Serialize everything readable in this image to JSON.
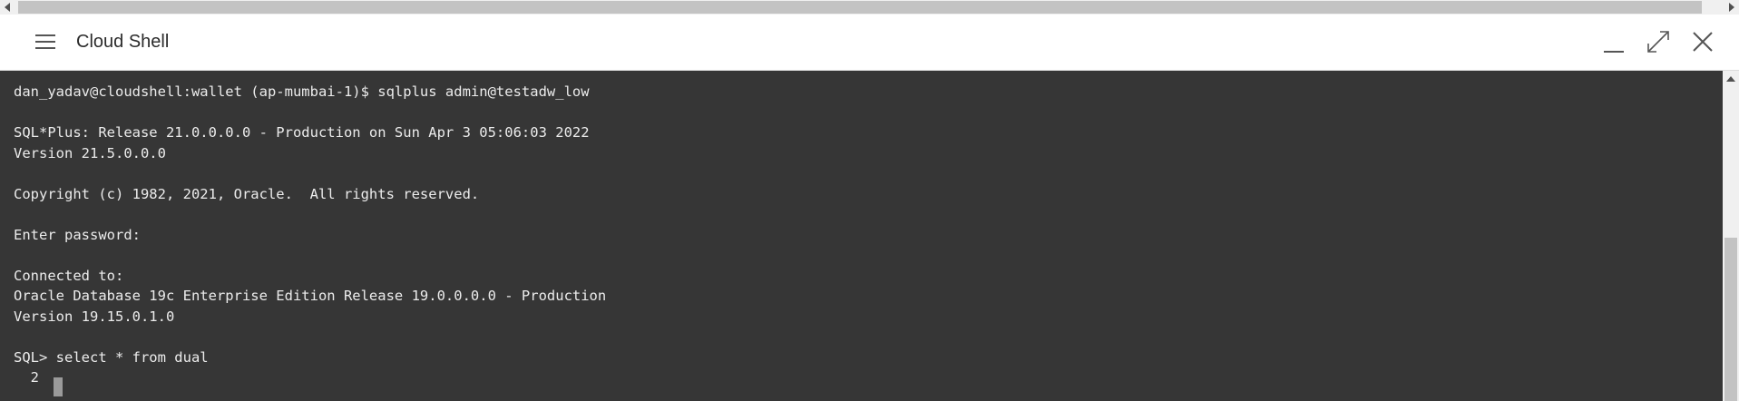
{
  "window": {
    "title": "Cloud Shell"
  },
  "header_icons": {
    "menu": "hamburger-menu-icon",
    "minimize": "minimize-icon",
    "maximize": "maximize-icon",
    "close": "close-icon"
  },
  "terminal": {
    "lines": [
      "dan_yadav@cloudshell:wallet (ap-mumbai-1)$ sqlplus admin@testadw_low",
      "",
      "SQL*Plus: Release 21.0.0.0.0 - Production on Sun Apr 3 05:06:03 2022",
      "Version 21.5.0.0.0",
      "",
      "Copyright (c) 1982, 2021, Oracle.  All rights reserved.",
      "",
      "Enter password:",
      "",
      "Connected to:",
      "Oracle Database 19c Enterprise Edition Release 19.0.0.0.0 - Production",
      "Version 19.15.0.1.0",
      "",
      "SQL> select * from dual",
      "  2"
    ]
  },
  "colors": {
    "terminal_bg": "#363636",
    "terminal_fg": "#ececec",
    "header_bg": "#ffffff",
    "scrollbar_track": "#f0f0f0",
    "scrollbar_thumb": "#c3c3c3"
  }
}
